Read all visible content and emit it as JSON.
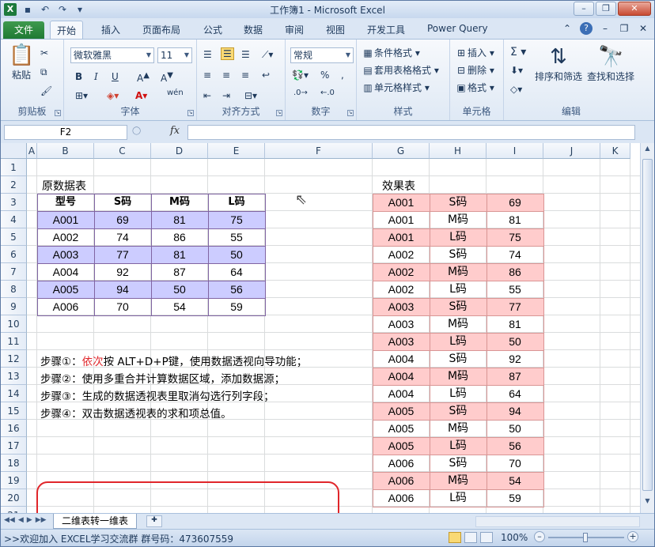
{
  "window": {
    "title": "工作簿1 - Microsoft Excel",
    "logo": "X",
    "qat_icons": [
      "save-icon",
      "undo-icon",
      "redo-icon",
      "customize-icon"
    ],
    "controls": [
      "minimize-icon",
      "restore-icon",
      "close-icon"
    ]
  },
  "tabs": {
    "file": "文件",
    "items": [
      "开始",
      "插入",
      "页面布局",
      "公式",
      "数据",
      "审阅",
      "视图",
      "开发工具",
      "Power Query"
    ],
    "active": "开始"
  },
  "ribbon": {
    "clipboard": {
      "label": "剪贴板",
      "paste": "粘贴"
    },
    "font": {
      "label": "字体",
      "font_name": "微软雅黑",
      "font_size": "11",
      "bold": "B",
      "italic": "I",
      "underline": "U",
      "wen": "wén"
    },
    "alignment": {
      "label": "对齐方式"
    },
    "number": {
      "label": "数字",
      "format": "常规",
      "percent": "%",
      "comma": ","
    },
    "styles": {
      "label": "样式",
      "conditional": "条件格式",
      "table": "套用表格格式",
      "cell": "单元格样式"
    },
    "cells": {
      "label": "单元格",
      "insert": "插入",
      "delete": "删除",
      "format": "格式"
    },
    "editing": {
      "label": "编辑",
      "sort": "排序和筛选",
      "find": "查找和选择",
      "sigma": "Σ"
    }
  },
  "formula_bar": {
    "name_box": "F2",
    "fx": "fx",
    "value": ""
  },
  "columns": [
    "A",
    "B",
    "C",
    "D",
    "E",
    "F",
    "G",
    "H",
    "I",
    "J",
    "K"
  ],
  "rows": [
    "1",
    "2",
    "3",
    "4",
    "5",
    "6",
    "7",
    "8",
    "9",
    "10",
    "11",
    "12",
    "13",
    "14",
    "15",
    "16",
    "17",
    "18",
    "19",
    "20",
    "21"
  ],
  "source_table": {
    "title": "原数据表",
    "headers": [
      "型号",
      "S码",
      "M码",
      "L码"
    ],
    "rows": [
      [
        "A001",
        "69",
        "81",
        "75"
      ],
      [
        "A002",
        "74",
        "86",
        "55"
      ],
      [
        "A003",
        "77",
        "81",
        "50"
      ],
      [
        "A004",
        "92",
        "87",
        "64"
      ],
      [
        "A005",
        "94",
        "50",
        "56"
      ],
      [
        "A006",
        "70",
        "54",
        "59"
      ]
    ]
  },
  "result_table": {
    "title": "效果表",
    "rows": [
      [
        "A001",
        "S码",
        "69"
      ],
      [
        "A001",
        "M码",
        "81"
      ],
      [
        "A001",
        "L码",
        "75"
      ],
      [
        "A002",
        "S码",
        "74"
      ],
      [
        "A002",
        "M码",
        "86"
      ],
      [
        "A002",
        "L码",
        "55"
      ],
      [
        "A003",
        "S码",
        "77"
      ],
      [
        "A003",
        "M码",
        "81"
      ],
      [
        "A003",
        "L码",
        "50"
      ],
      [
        "A004",
        "S码",
        "92"
      ],
      [
        "A004",
        "M码",
        "87"
      ],
      [
        "A004",
        "L码",
        "64"
      ],
      [
        "A005",
        "S码",
        "94"
      ],
      [
        "A005",
        "M码",
        "50"
      ],
      [
        "A005",
        "L码",
        "56"
      ],
      [
        "A006",
        "S码",
        "70"
      ],
      [
        "A006",
        "M码",
        "54"
      ],
      [
        "A006",
        "L码",
        "59"
      ]
    ]
  },
  "steps": [
    {
      "prefix": "步骤①：",
      "highlight": "依次",
      "rest": "按 ALT+D+P键，使用数据透视向导功能；"
    },
    {
      "prefix": "步骤②：",
      "highlight": "",
      "rest": "使用多重合并计算数据区域，添加数据源；"
    },
    {
      "prefix": "步骤③：",
      "highlight": "",
      "rest": "生成的数据透视表里取消勾选行列字段；"
    },
    {
      "prefix": "步骤④：",
      "highlight": "",
      "rest": "双击数据透视表的求和项总值。"
    }
  ],
  "sheet_tab": "二维表转一维表",
  "status": {
    "text": ">>欢迎加入  EXCEL学习交流群     群号码：473607559",
    "zoom": "100%"
  },
  "colors": {
    "accent_green": "#1f7a34",
    "band_purple": "#ccccff",
    "result_pink": "#ffcccc",
    "callout_red": "#e0252a"
  }
}
